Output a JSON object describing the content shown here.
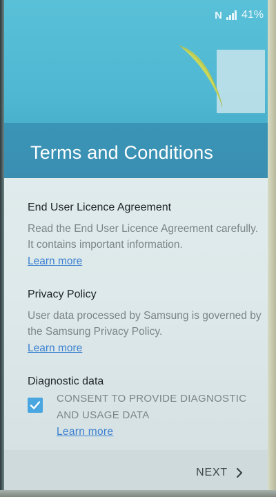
{
  "status_bar": {
    "battery": "41%",
    "nfc_icon": "nfc-icon",
    "signal_icon": "signal-icon"
  },
  "header": {
    "title": "Terms and Conditions"
  },
  "sections": [
    {
      "title": "End User Licence Agreement",
      "text": "Read the End User Licence Agreement carefully. It contains important information.",
      "link": "Learn more"
    },
    {
      "title": "Privacy Policy",
      "text": "User data processed by Samsung is governed by the Samsung Privacy Policy.",
      "link": "Learn more"
    }
  ],
  "diagnostic": {
    "title": "Diagnostic data",
    "consent": "CONSENT TO PROVIDE DIAGNOSTIC AND USAGE DATA",
    "checked": true,
    "link": "Learn more"
  },
  "footer": {
    "next_label": "NEXT"
  },
  "colors": {
    "header": "#4fb7d2",
    "header_band": "#3a8fb1",
    "link": "#3a7fd0",
    "checkbox": "#4aa6e0"
  }
}
